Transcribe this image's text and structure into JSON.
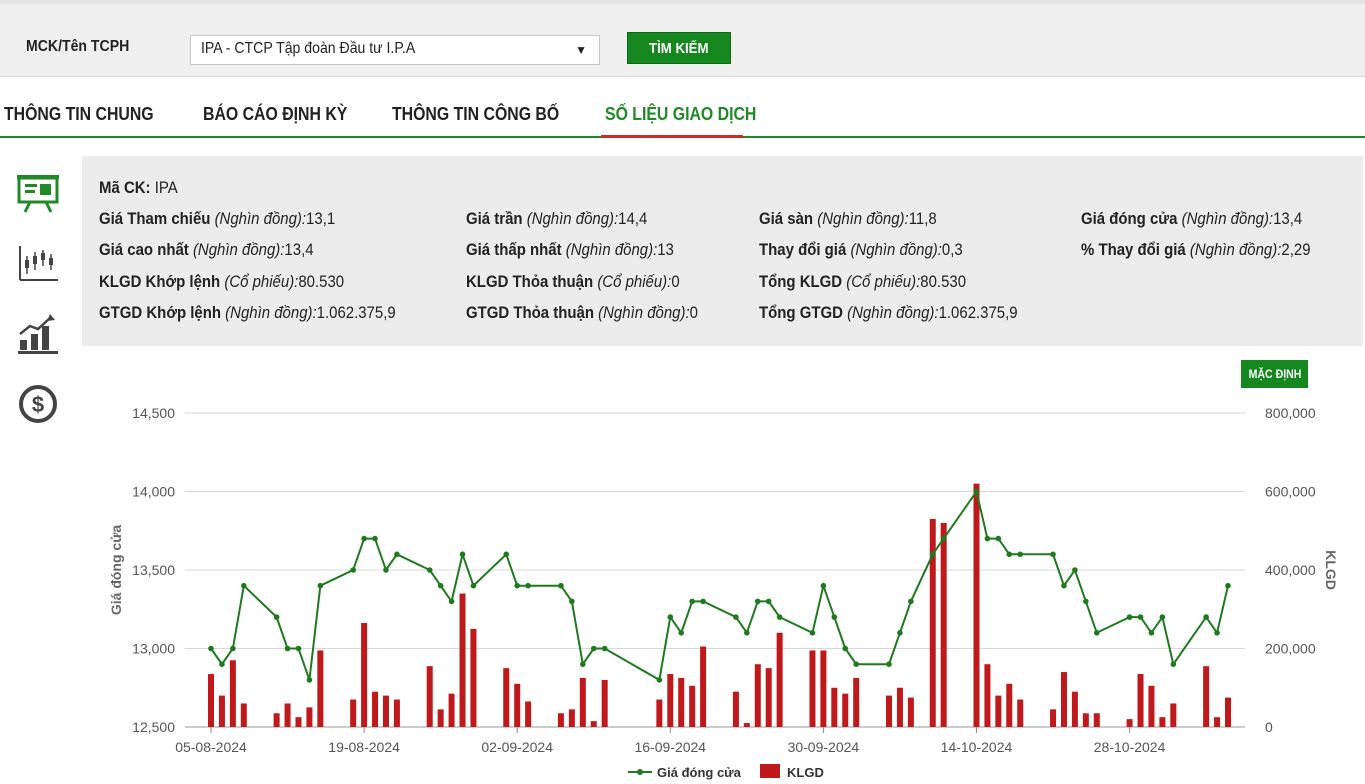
{
  "search": {
    "label": "MCK/Tên TCPH",
    "selected": "IPA - CTCP Tập đoàn Đầu tư I.P.A",
    "button": "TÌM KIẾM"
  },
  "tabs": [
    {
      "label": "THÔNG TIN CHUNG"
    },
    {
      "label": "BÁO CÁO ĐỊNH KỲ"
    },
    {
      "label": "THÔNG TIN CÔNG BỐ"
    },
    {
      "label": "SỐ LIỆU GIAO DỊCH"
    }
  ],
  "sidebar": {
    "icons": [
      "presentation-board-icon",
      "candlestick-chart-icon",
      "bar-growth-chart-icon",
      "dollar-coin-icon"
    ]
  },
  "info": {
    "ticker_label": "Mã CK:",
    "ticker_value": "IPA",
    "unit_price": "(Nghìn đồng):",
    "unit_share": "(Cổ phiếu):",
    "items": [
      {
        "label": "Giá Tham chiếu",
        "unit": "(Nghìn đồng):",
        "value": "13,1"
      },
      {
        "label": "Giá trần",
        "unit": "(Nghìn đồng):",
        "value": "14,4"
      },
      {
        "label": "Giá sàn",
        "unit": "(Nghìn đồng):",
        "value": "11,8"
      },
      {
        "label": "Giá đóng cửa",
        "unit": "(Nghìn đồng):",
        "value": "13,4"
      },
      {
        "label": "Giá cao nhất",
        "unit": "(Nghìn đồng):",
        "value": "13,4"
      },
      {
        "label": "Giá thấp nhất",
        "unit": "(Nghìn đồng):",
        "value": "13"
      },
      {
        "label": "Thay đổi giá",
        "unit": "(Nghìn đồng):",
        "value": "0,3"
      },
      {
        "label": "% Thay đổi giá",
        "unit": "(Nghìn đồng):",
        "value": "2,29"
      },
      {
        "label": "KLGD Khớp lệnh",
        "unit": "(Cổ phiếu):",
        "value": "80.530"
      },
      {
        "label": "KLGD Thỏa thuận",
        "unit": "(Cổ phiếu):",
        "value": "0"
      },
      {
        "label": "Tổng KLGD",
        "unit": "(Cổ phiếu):",
        "value": "80.530"
      },
      {
        "label": "GTGD Khớp lệnh",
        "unit": "(Nghìn đồng):",
        "value": "1.062.375,9"
      },
      {
        "label": "GTGD Thỏa thuận",
        "unit": "(Nghìn đồng):",
        "value": "0"
      },
      {
        "label": "Tổng GTGD",
        "unit": "(Nghìn đồng):",
        "value": "1.062.375,9"
      }
    ]
  },
  "chart_button": "MẶC ĐỊNH",
  "colors": {
    "accent": "#14871e",
    "line": "#1f7a1f",
    "bar": "#c0191b",
    "tab_underline": "#d42a2a"
  },
  "chart_data": {
    "type": "line+bar",
    "ylabel_left": "Giá đóng cửa",
    "ylabel_right": "KLGD",
    "y_left_ticks": [
      "12,500",
      "13,000",
      "13,500",
      "14,000",
      "14,500"
    ],
    "y_left_range": [
      12500,
      14500
    ],
    "y_right_ticks": [
      "0",
      "200,000",
      "400,000",
      "600,000",
      "800,000"
    ],
    "y_right_range": [
      0,
      800000
    ],
    "x_ticks": [
      "05-08-2024",
      "19-08-2024",
      "02-09-2024",
      "16-09-2024",
      "30-09-2024",
      "14-10-2024",
      "28-10-2024"
    ],
    "x_tick_day_index": [
      0,
      14,
      28,
      42,
      56,
      70,
      84
    ],
    "legend": [
      "Giá đóng cửa",
      "KLGD"
    ],
    "series": [
      {
        "name": "Giá đóng cửa",
        "points": [
          [
            0,
            13000
          ],
          [
            1,
            12900
          ],
          [
            2,
            13000
          ],
          [
            3,
            13400
          ],
          [
            6,
            13200
          ],
          [
            7,
            13000
          ],
          [
            8,
            13000
          ],
          [
            9,
            12800
          ],
          [
            10,
            13400
          ],
          [
            13,
            13500
          ],
          [
            14,
            13700
          ],
          [
            15,
            13700
          ],
          [
            16,
            13500
          ],
          [
            17,
            13600
          ],
          [
            20,
            13500
          ],
          [
            21,
            13400
          ],
          [
            22,
            13300
          ],
          [
            23,
            13600
          ],
          [
            24,
            13400
          ],
          [
            27,
            13600
          ],
          [
            28,
            13400
          ],
          [
            29,
            13400
          ],
          [
            32,
            13400
          ],
          [
            33,
            13300
          ],
          [
            34,
            12900
          ],
          [
            35,
            13000
          ],
          [
            36,
            13000
          ],
          [
            41,
            12800
          ],
          [
            42,
            13200
          ],
          [
            43,
            13100
          ],
          [
            44,
            13300
          ],
          [
            45,
            13300
          ],
          [
            48,
            13200
          ],
          [
            49,
            13100
          ],
          [
            50,
            13300
          ],
          [
            51,
            13300
          ],
          [
            52,
            13200
          ],
          [
            55,
            13100
          ],
          [
            56,
            13400
          ],
          [
            57,
            13200
          ],
          [
            58,
            13000
          ],
          [
            59,
            12900
          ],
          [
            62,
            12900
          ],
          [
            63,
            13100
          ],
          [
            64,
            13300
          ],
          [
            66,
            13600
          ],
          [
            67,
            13700
          ],
          [
            70,
            14000
          ],
          [
            71,
            13700
          ],
          [
            72,
            13700
          ],
          [
            73,
            13600
          ],
          [
            74,
            13600
          ],
          [
            77,
            13600
          ],
          [
            78,
            13400
          ],
          [
            79,
            13500
          ],
          [
            80,
            13300
          ],
          [
            81,
            13100
          ],
          [
            84,
            13200
          ],
          [
            85,
            13200
          ],
          [
            86,
            13100
          ],
          [
            87,
            13200
          ],
          [
            88,
            12900
          ],
          [
            91,
            13200
          ],
          [
            92,
            13100
          ],
          [
            93,
            13400
          ]
        ]
      },
      {
        "name": "KLGD",
        "points": [
          [
            0,
            135000
          ],
          [
            1,
            80000
          ],
          [
            2,
            170000
          ],
          [
            3,
            60000
          ],
          [
            6,
            35000
          ],
          [
            7,
            60000
          ],
          [
            8,
            25000
          ],
          [
            9,
            50000
          ],
          [
            10,
            195000
          ],
          [
            13,
            70000
          ],
          [
            14,
            265000
          ],
          [
            15,
            90000
          ],
          [
            16,
            80000
          ],
          [
            17,
            70000
          ],
          [
            20,
            155000
          ],
          [
            21,
            45000
          ],
          [
            22,
            85000
          ],
          [
            23,
            340000
          ],
          [
            24,
            250000
          ],
          [
            27,
            150000
          ],
          [
            28,
            110000
          ],
          [
            29,
            65000
          ],
          [
            32,
            35000
          ],
          [
            33,
            45000
          ],
          [
            34,
            125000
          ],
          [
            35,
            15000
          ],
          [
            36,
            120000
          ],
          [
            41,
            70000
          ],
          [
            42,
            135000
          ],
          [
            43,
            125000
          ],
          [
            44,
            105000
          ],
          [
            45,
            205000
          ],
          [
            48,
            90000
          ],
          [
            49,
            10000
          ],
          [
            50,
            160000
          ],
          [
            51,
            150000
          ],
          [
            52,
            240000
          ],
          [
            55,
            195000
          ],
          [
            56,
            195000
          ],
          [
            57,
            100000
          ],
          [
            58,
            85000
          ],
          [
            59,
            125000
          ],
          [
            62,
            80000
          ],
          [
            63,
            100000
          ],
          [
            64,
            75000
          ],
          [
            66,
            530000
          ],
          [
            67,
            520000
          ],
          [
            70,
            620000
          ],
          [
            71,
            160000
          ],
          [
            72,
            80000
          ],
          [
            73,
            110000
          ],
          [
            74,
            70000
          ],
          [
            77,
            45000
          ],
          [
            78,
            140000
          ],
          [
            79,
            90000
          ],
          [
            80,
            35000
          ],
          [
            81,
            35000
          ],
          [
            84,
            20000
          ],
          [
            85,
            135000
          ],
          [
            86,
            105000
          ],
          [
            87,
            25000
          ],
          [
            88,
            60000
          ],
          [
            91,
            155000
          ],
          [
            92,
            25000
          ],
          [
            93,
            75000
          ]
        ]
      }
    ]
  }
}
